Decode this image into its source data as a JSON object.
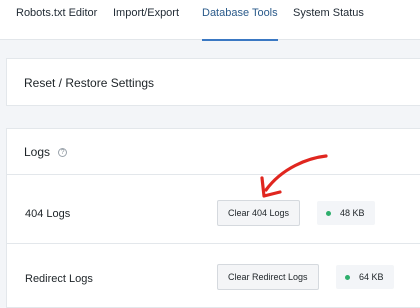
{
  "tabs": [
    {
      "label": "Robots.txt Editor",
      "active": false
    },
    {
      "label": "Import/Export",
      "active": false
    },
    {
      "label": "Database Tools",
      "active": true
    },
    {
      "label": "System Status",
      "active": false
    }
  ],
  "reset_card": {
    "title": "Reset / Restore Settings"
  },
  "logs_card": {
    "title": "Logs",
    "help_icon": "?",
    "rows": [
      {
        "label": "404 Logs",
        "button": "Clear 404 Logs",
        "size": "48 KB"
      },
      {
        "label": "Redirect Logs",
        "button": "Clear Redirect Logs",
        "size": "64 KB"
      }
    ]
  },
  "colors": {
    "accent": "#3a78c3",
    "status_ok": "#2eae6c",
    "annotation_arrow": "#e0261f"
  }
}
